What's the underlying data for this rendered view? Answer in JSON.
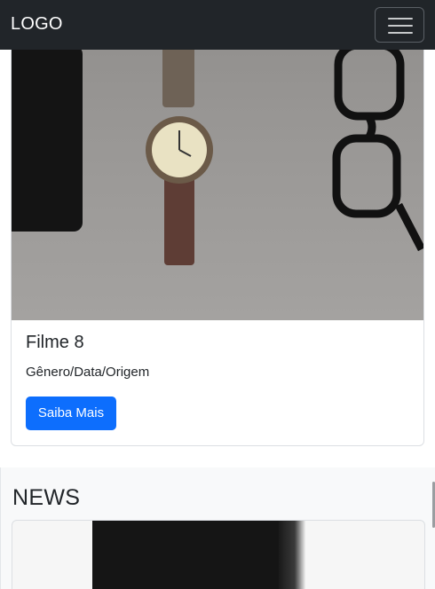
{
  "navbar": {
    "brand": "LOGO",
    "toggle_icon": "hamburger-menu-icon"
  },
  "card": {
    "image_alt": "watch-phone-glasses-photo",
    "title": "Filme 8",
    "meta": "Gênero/Data/Origem",
    "button_label": "Saiba Mais"
  },
  "news": {
    "heading": "NEWS",
    "image_alt": "news-photo"
  },
  "colors": {
    "navbar_bg": "#212529",
    "primary_button": "#0d6efd",
    "section_bg": "#f8f9fa"
  }
}
